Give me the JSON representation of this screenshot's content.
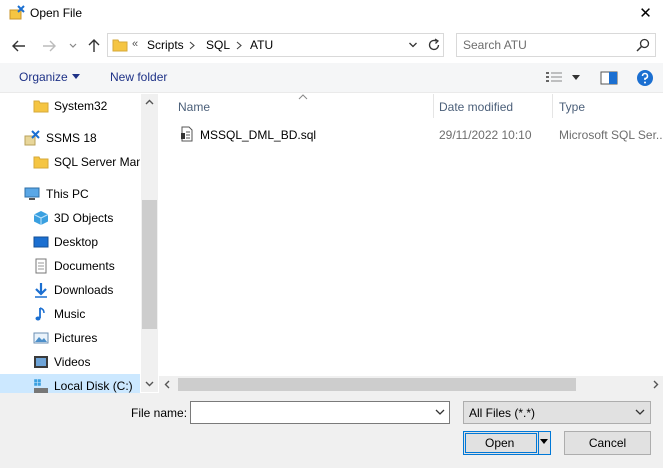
{
  "window": {
    "title": "Open File",
    "close_glyph": "✕"
  },
  "nav": {
    "overflow_glyph": "«",
    "breadcrumbs": [
      "Scripts",
      "SQL",
      "ATU"
    ],
    "search_placeholder": "Search ATU"
  },
  "toolbar": {
    "organize_label": "Organize",
    "new_folder_label": "New folder"
  },
  "tree": [
    {
      "label": "System32",
      "icon": "folder-icon"
    },
    {
      "label": "SSMS 18",
      "icon": "ssms-icon"
    },
    {
      "label": "SQL Server Mana",
      "icon": "folder-icon"
    },
    {
      "label": "This PC",
      "icon": "computer-icon"
    },
    {
      "label": "3D Objects",
      "icon": "cube-icon"
    },
    {
      "label": "Desktop",
      "icon": "desktop-icon"
    },
    {
      "label": "Documents",
      "icon": "document-icon"
    },
    {
      "label": "Downloads",
      "icon": "download-icon"
    },
    {
      "label": "Music",
      "icon": "music-icon"
    },
    {
      "label": "Pictures",
      "icon": "picture-icon"
    },
    {
      "label": "Videos",
      "icon": "video-icon"
    },
    {
      "label": "Local Disk (C:)",
      "icon": "disk-icon",
      "selected": true
    }
  ],
  "columns": {
    "name": "Name",
    "date": "Date modified",
    "type": "Type"
  },
  "files": [
    {
      "name": "MSSQL_DML_BD.sql",
      "date": "29/11/2022 10:10",
      "type": "Microsoft SQL Ser..."
    }
  ],
  "footer": {
    "file_name_label": "File name:",
    "file_name_value": "",
    "file_type": "All Files (*.*)",
    "open_label": "Open",
    "cancel_label": "Cancel"
  },
  "colors": {
    "accent": "#0078d7",
    "link": "#1e3287",
    "selection": "#cce8ff",
    "folder": "#f5c542"
  }
}
